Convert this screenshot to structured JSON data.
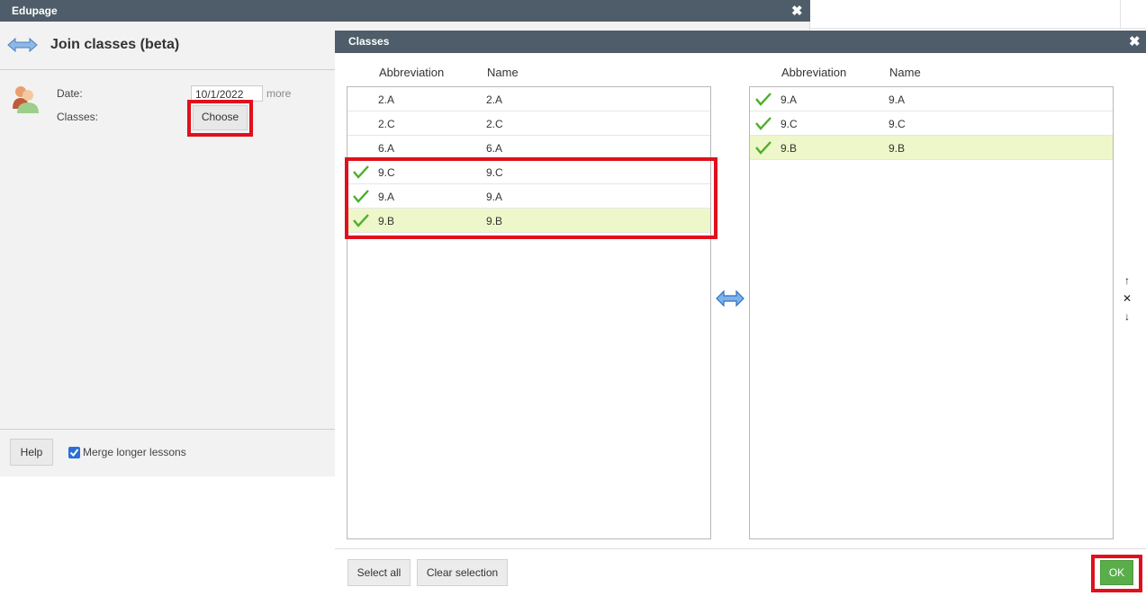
{
  "background_window": {
    "title": "Edupage",
    "close_glyph": "✖",
    "header_title": "Join classes (beta)",
    "date_label": "Date:",
    "date_value": "10/1/2022",
    "more_link": "more",
    "classes_label": "Classes:",
    "choose_button": "Choose",
    "help_button": "Help",
    "merge_label": "Merge longer lessons",
    "merge_checked": true
  },
  "dialog": {
    "title": "Classes",
    "close_glyph": "✖",
    "left_list": {
      "headers": {
        "abbreviation": "Abbreviation",
        "name": "Name"
      },
      "rows": [
        {
          "abbreviation": "2.A",
          "name": "2.A",
          "checked": false,
          "selected": false
        },
        {
          "abbreviation": "2.C",
          "name": "2.C",
          "checked": false,
          "selected": false
        },
        {
          "abbreviation": "6.A",
          "name": "6.A",
          "checked": false,
          "selected": false
        },
        {
          "abbreviation": "9.C",
          "name": "9.C",
          "checked": true,
          "selected": false
        },
        {
          "abbreviation": "9.A",
          "name": "9.A",
          "checked": true,
          "selected": false
        },
        {
          "abbreviation": "9.B",
          "name": "9.B",
          "checked": true,
          "selected": true
        }
      ]
    },
    "right_list": {
      "headers": {
        "abbreviation": "Abbreviation",
        "name": "Name"
      },
      "rows": [
        {
          "abbreviation": "9.A",
          "name": "9.A",
          "checked": true,
          "selected": false
        },
        {
          "abbreviation": "9.C",
          "name": "9.C",
          "checked": true,
          "selected": false
        },
        {
          "abbreviation": "9.B",
          "name": "9.B",
          "checked": true,
          "selected": true
        }
      ]
    },
    "order_controls": {
      "up": "↑",
      "remove": "✕",
      "down": "↓"
    },
    "select_all_button": "Select all",
    "clear_selection_button": "Clear selection",
    "ok_button": "OK"
  },
  "colors": {
    "titlebar": "#4e5d69",
    "selected_row": "#eef7c9",
    "check_green": "#4caf2a",
    "ok_green": "#5aae4a",
    "highlight_red": "#e0101c",
    "swap_blue": "#4a90d9"
  },
  "icons": {
    "join_icon": "double-arrow-icon",
    "swap_icon": "swap-arrows-icon",
    "check_icon": "check-icon",
    "avatar_icon": "users-icon"
  }
}
